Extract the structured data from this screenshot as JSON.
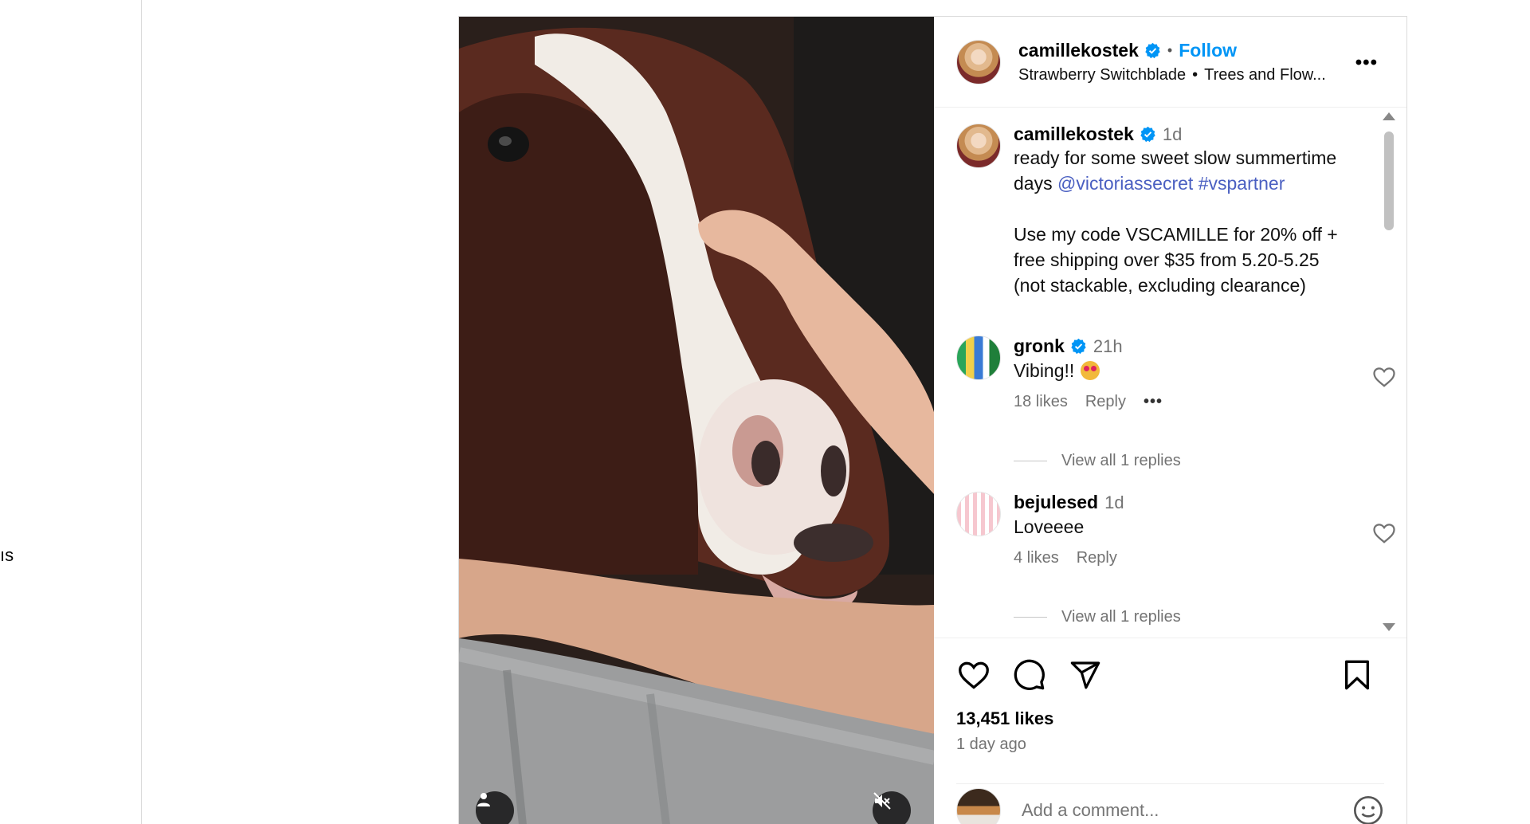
{
  "nav": {
    "stub_text": "ıs"
  },
  "post": {
    "username": "camillekostek",
    "follow_label": "Follow",
    "dot": "•",
    "audio": {
      "track": "Strawberry Switchblade",
      "sep": "•",
      "artist": "Trees and Flow..."
    },
    "more_label": "•••",
    "colors": {
      "follow": "#0095f6",
      "link": "#4a5fc1",
      "verified": "#0095f6",
      "muted_text": "#737373"
    }
  },
  "caption": {
    "username": "camillekostek",
    "time": "1d",
    "line1": "ready for some sweet slow summertime days",
    "mention": "@victoriassecret",
    "hashtag": "#vspartner",
    "promo": "Use my code VSCAMILLE for 20% off + free shipping over $35 from 5.20-5.25 (not stackable, excluding clearance)"
  },
  "comments": [
    {
      "username": "gronk",
      "verified": true,
      "time": "21h",
      "text": "Vibing!!",
      "likes": "18 likes",
      "reply": "Reply",
      "more": "•••",
      "view_replies": "View all 1 replies"
    },
    {
      "username": "bejulesed",
      "verified": false,
      "time": "1d",
      "text": "Loveeee",
      "likes": "4 likes",
      "reply": "Reply",
      "view_replies": "View all 1 replies"
    }
  ],
  "actions": {
    "icons": [
      "heart-icon",
      "comment-icon",
      "share-icon",
      "bookmark-icon"
    ],
    "likes": "13,451 likes",
    "time_ago": "1 day ago",
    "comment_placeholder": "Add a comment..."
  },
  "media": {
    "icons": [
      "user-tag-icon",
      "muted-speaker-icon"
    ]
  }
}
